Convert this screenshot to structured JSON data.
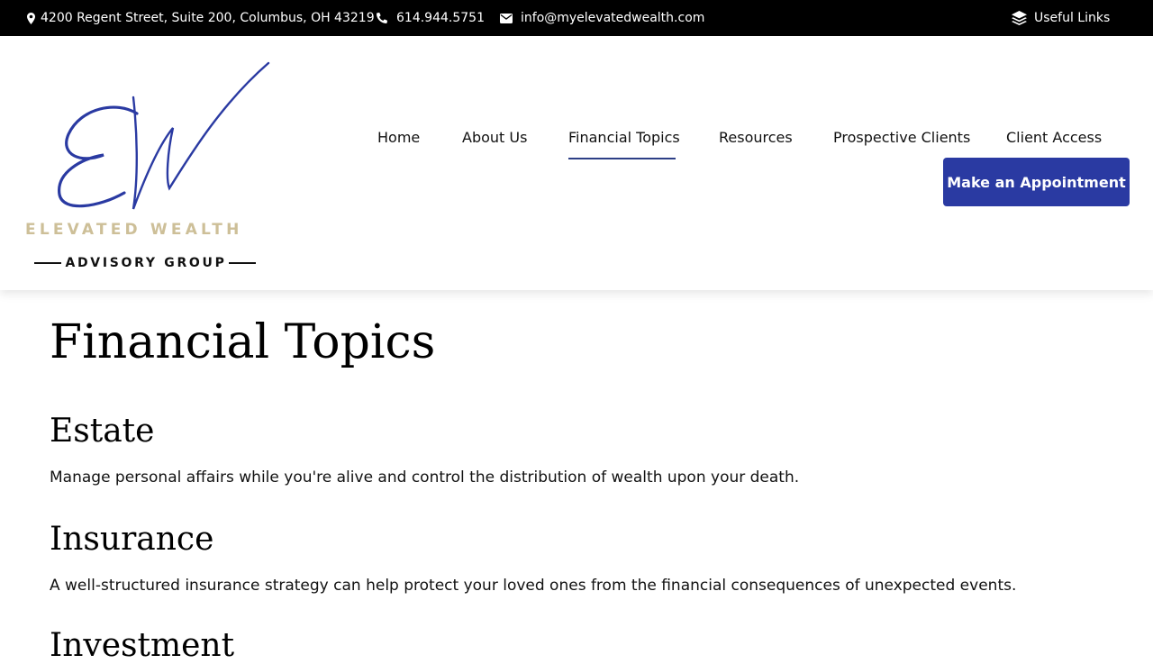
{
  "topbar": {
    "address": "4200 Regent Street, Suite 200, Columbus, OH 43219",
    "phone": "614.944.5751",
    "email": "info@myelevatedwealth.com",
    "useful_links": "Useful Links"
  },
  "logo": {
    "line1": "ELEVATED WEALTH",
    "line2": "ADVISORY GROUP",
    "mark_color": "#2a3aa2",
    "gold_color": "#cdbf98"
  },
  "nav": {
    "items": [
      {
        "label": "Home",
        "active": false
      },
      {
        "label": "About Us",
        "active": false
      },
      {
        "label": "Financial Topics",
        "active": true
      },
      {
        "label": "Resources",
        "active": false
      },
      {
        "label": "Prospective Clients",
        "active": false
      },
      {
        "label": "Client Access",
        "active": false
      }
    ],
    "cta": "Make an Appointment"
  },
  "main": {
    "title": "Financial Topics",
    "sections": [
      {
        "title": "Estate",
        "description": "Manage personal affairs while you're alive and control the distribution of wealth upon your death."
      },
      {
        "title": "Insurance",
        "description": "A well-structured insurance strategy can help protect your loved ones from the financial consequences of unexpected events."
      },
      {
        "title": "Investment",
        "description": ""
      }
    ]
  },
  "icons": {
    "address": "map-marker-icon",
    "phone": "phone-icon",
    "email": "envelope-icon",
    "useful_links": "layers-icon"
  },
  "colors": {
    "topbar_bg": "#000000",
    "accent": "#2a3aa2",
    "underline": "#2d3f86"
  }
}
